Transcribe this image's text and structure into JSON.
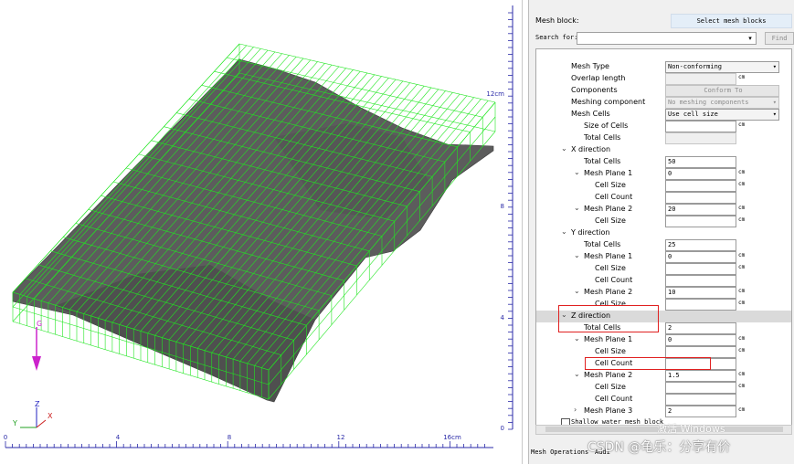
{
  "viewport": {
    "ruler_bottom_ticks": [
      "0",
      "4",
      "8",
      "12",
      "16cm"
    ],
    "ruler_right_ticks": [
      "12cm",
      "8",
      "4",
      "0"
    ],
    "axis_gizmo": {
      "z": "Z",
      "y": "Y",
      "x": "X"
    },
    "gravity_label": "G",
    "colors": {
      "mesh": "#22e622",
      "surface": "#5a5a5a",
      "ruler": "#2a2aa8",
      "gravity": "#cc22cc"
    }
  },
  "panel": {
    "mesh_block_label": "Mesh block:",
    "select_mesh_blocks_label": "Select mesh blocks",
    "search_label": "Search for:",
    "search_value": "",
    "find_label": "Find",
    "tree": [
      {
        "name": "Mesh Type",
        "indent": 0,
        "value": "Non-conforming",
        "kind": "dropdown"
      },
      {
        "name": "Overlap length",
        "indent": 0,
        "value": "",
        "kind": "gray",
        "unit": "cm"
      },
      {
        "name": "Components",
        "indent": 0,
        "value": "Conform To",
        "kind": "button"
      },
      {
        "name": "Meshing component",
        "indent": 0,
        "value": "No meshing components",
        "kind": "dropdown-disabled"
      },
      {
        "name": "Mesh Cells",
        "indent": 0,
        "value": "Use cell size",
        "kind": "dropdown"
      },
      {
        "name": "Size of Cells",
        "indent": 1,
        "value": "",
        "kind": "input",
        "unit": "cm"
      },
      {
        "name": "Total Cells",
        "indent": 1,
        "value": "",
        "kind": "gray"
      },
      {
        "name": "X direction",
        "indent": 0,
        "kind": "section",
        "chevron": "v"
      },
      {
        "name": "Total Cells",
        "indent": 1,
        "value": "50",
        "kind": "input"
      },
      {
        "name": "Mesh Plane 1",
        "indent": 1,
        "value": "0",
        "kind": "input",
        "unit": "cm",
        "chevron": "v"
      },
      {
        "name": "Cell Size",
        "indent": 2,
        "value": "",
        "kind": "input",
        "unit": "cm"
      },
      {
        "name": "Cell Count",
        "indent": 2,
        "value": "",
        "kind": "input"
      },
      {
        "name": "Mesh Plane 2",
        "indent": 1,
        "value": "20",
        "kind": "input",
        "unit": "cm",
        "chevron": "v"
      },
      {
        "name": "Cell Size",
        "indent": 2,
        "value": "",
        "kind": "input",
        "unit": "cm"
      },
      {
        "name": "Y direction",
        "indent": 0,
        "kind": "section",
        "chevron": "v"
      },
      {
        "name": "Total Cells",
        "indent": 1,
        "value": "25",
        "kind": "input"
      },
      {
        "name": "Mesh Plane 1",
        "indent": 1,
        "value": "0",
        "kind": "input",
        "unit": "cm",
        "chevron": "v"
      },
      {
        "name": "Cell Size",
        "indent": 2,
        "value": "",
        "kind": "input",
        "unit": "cm"
      },
      {
        "name": "Cell Count",
        "indent": 2,
        "value": "",
        "kind": "input"
      },
      {
        "name": "Mesh Plane 2",
        "indent": 1,
        "value": "10",
        "kind": "input",
        "unit": "cm",
        "chevron": "v"
      },
      {
        "name": "Cell Size",
        "indent": 2,
        "value": "",
        "kind": "input",
        "unit": "cm"
      },
      {
        "name": "Z direction",
        "indent": 0,
        "kind": "section",
        "chevron": "v",
        "highlight": true
      },
      {
        "name": "Total Cells",
        "indent": 1,
        "value": "2",
        "kind": "input"
      },
      {
        "name": "Mesh Plane 1",
        "indent": 1,
        "value": "0",
        "kind": "input",
        "unit": "cm",
        "chevron": "v"
      },
      {
        "name": "Cell Size",
        "indent": 2,
        "value": "",
        "kind": "input",
        "unit": "cm"
      },
      {
        "name": "Cell Count",
        "indent": 2,
        "value": "",
        "kind": "input"
      },
      {
        "name": "Mesh Plane 2",
        "indent": 1,
        "value": "1.5",
        "kind": "input",
        "unit": "cm",
        "chevron": "v"
      },
      {
        "name": "Cell Size",
        "indent": 2,
        "value": "",
        "kind": "input",
        "unit": "cm"
      },
      {
        "name": "Cell Count",
        "indent": 2,
        "value": "",
        "kind": "input"
      },
      {
        "name": "Mesh Plane 3",
        "indent": 1,
        "value": "2",
        "kind": "input",
        "unit": "cm",
        "chevron": ">"
      }
    ],
    "shallow_water_label": "Shallow water mesh block",
    "bottom_tabs": [
      "Mesh Operations",
      "Addi"
    ],
    "watermark_activate": "激活 Windows",
    "watermark_csdn": "CSDN @龟乐：分享有价"
  }
}
